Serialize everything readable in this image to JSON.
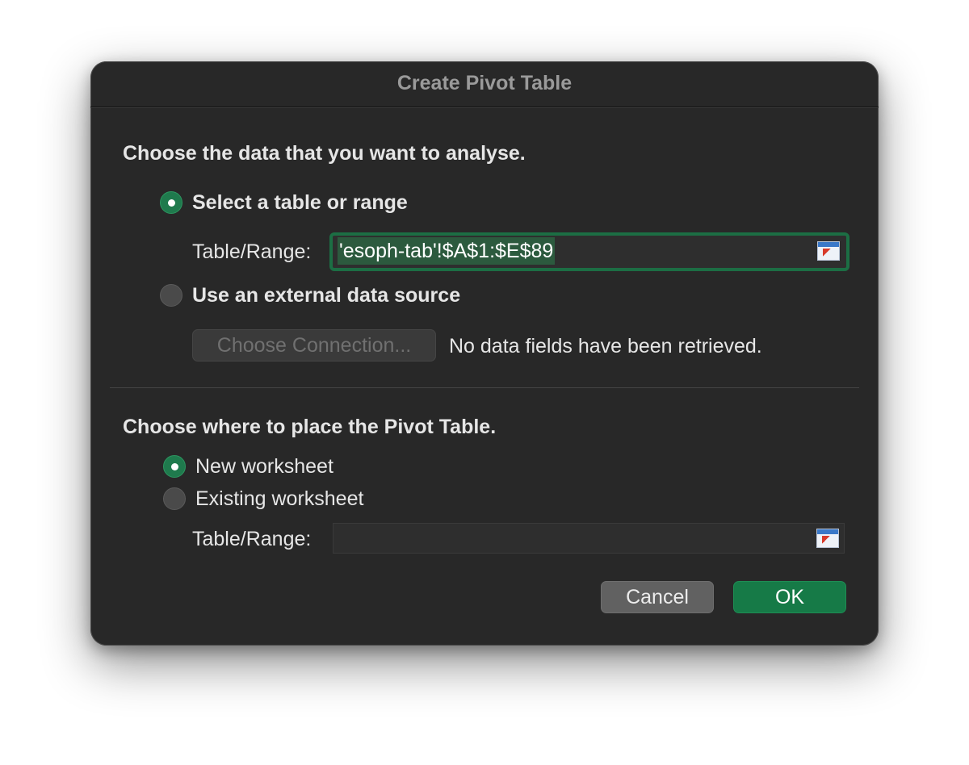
{
  "dialog": {
    "title": "Create Pivot Table",
    "source_section": {
      "heading": "Choose the data that you want to analyse.",
      "option_table": {
        "label": "Select a table or range",
        "selected": true
      },
      "range_label": "Table/Range:",
      "range_value": "'esoph-tab'!$A$1:$E$89",
      "option_external": {
        "label": "Use an external data source",
        "selected": false
      },
      "choose_connection_label": "Choose Connection...",
      "no_fields_text": "No data fields have been retrieved."
    },
    "placement_section": {
      "heading": "Choose where to place the Pivot Table.",
      "option_new": {
        "label": "New worksheet",
        "selected": true
      },
      "option_existing": {
        "label": "Existing worksheet",
        "selected": false
      },
      "range_label": "Table/Range:",
      "range_value": ""
    },
    "buttons": {
      "cancel": "Cancel",
      "ok": "OK"
    },
    "colors": {
      "accent": "#167a47",
      "background": "#282828"
    },
    "icons": [
      "range-picker-icon",
      "range-picker-icon"
    ]
  }
}
